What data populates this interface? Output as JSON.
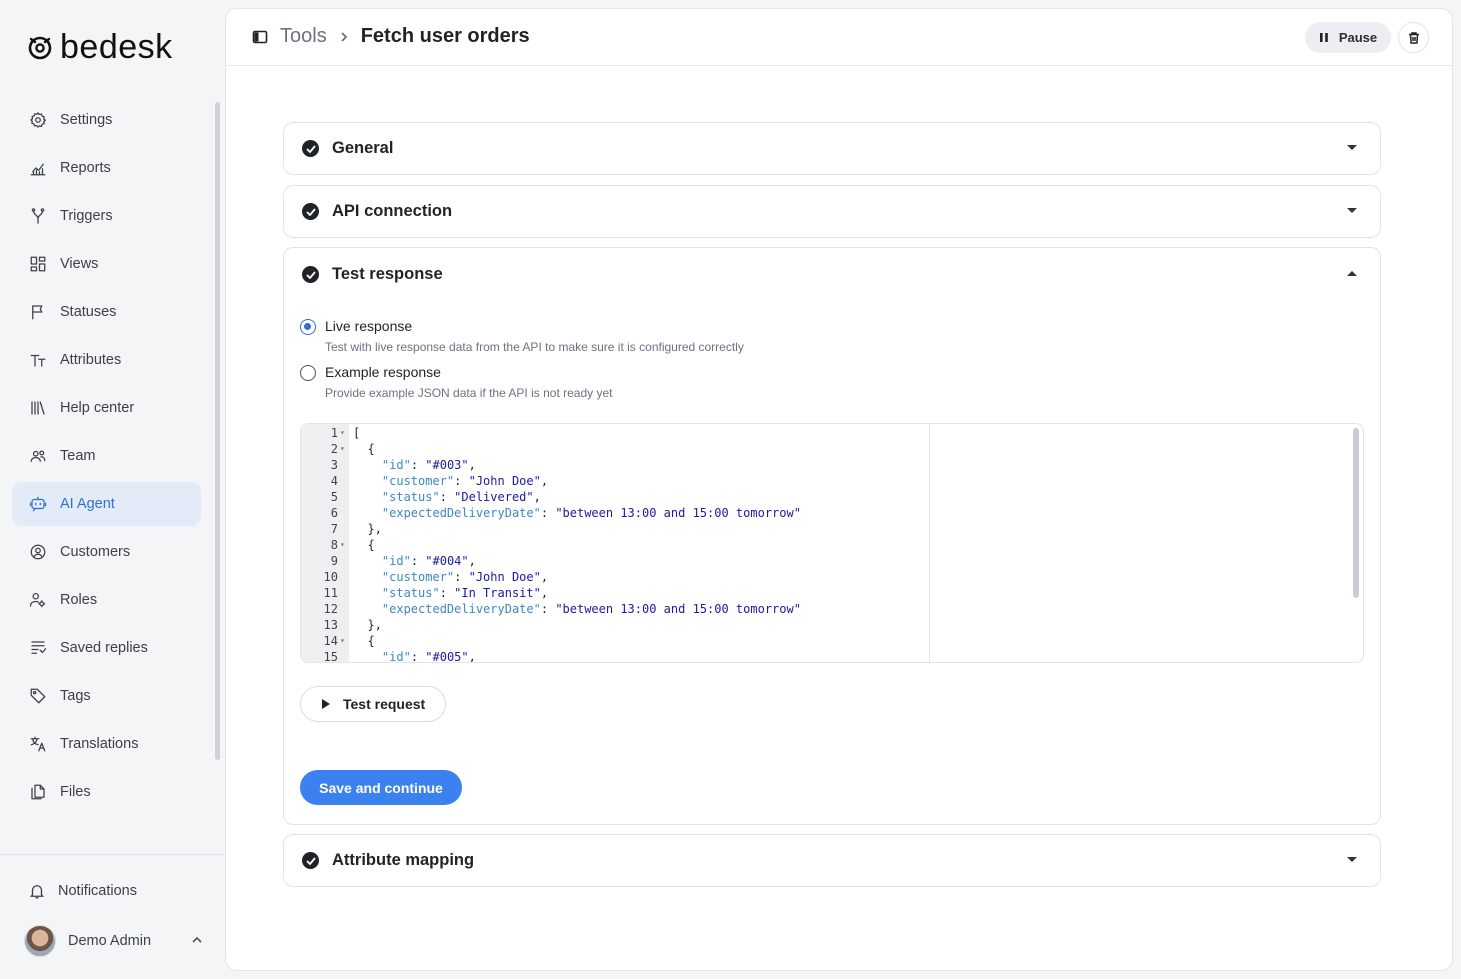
{
  "app": {
    "logo_text": "bedesk"
  },
  "sidebar": {
    "items": [
      {
        "label": "Settings",
        "icon": "gear-icon"
      },
      {
        "label": "Reports",
        "icon": "chart-icon"
      },
      {
        "label": "Triggers",
        "icon": "fork-icon"
      },
      {
        "label": "Views",
        "icon": "grid-icon"
      },
      {
        "label": "Statuses",
        "icon": "flag-icon"
      },
      {
        "label": "Attributes",
        "icon": "text-icon"
      },
      {
        "label": "Help center",
        "icon": "library-icon"
      },
      {
        "label": "Team",
        "icon": "team-icon"
      },
      {
        "label": "AI Agent",
        "icon": "bot-icon",
        "active": true
      },
      {
        "label": "Customers",
        "icon": "user-circle-icon"
      },
      {
        "label": "Roles",
        "icon": "user-gear-icon"
      },
      {
        "label": "Saved replies",
        "icon": "saved-reply-icon"
      },
      {
        "label": "Tags",
        "icon": "tag-icon"
      },
      {
        "label": "Translations",
        "icon": "translate-icon"
      },
      {
        "label": "Files",
        "icon": "files-icon"
      }
    ],
    "notifications_label": "Notifications",
    "user_name": "Demo Admin"
  },
  "header": {
    "breadcrumb_parent": "Tools",
    "title": "Fetch user orders",
    "pause_label": "Pause"
  },
  "sections": {
    "general": "General",
    "api_connection": "API connection",
    "test_response": "Test response",
    "attribute_mapping": "Attribute mapping"
  },
  "test_response": {
    "options": [
      {
        "label": "Live response",
        "description": "Test with live response data from the API to make sure it is configured correctly",
        "selected": true
      },
      {
        "label": "Example response",
        "description": "Provide example JSON data if the API is not ready yet",
        "selected": false
      }
    ],
    "editor_lines": [
      "[",
      "  {",
      "    \"id\": \"#003\",",
      "    \"customer\": \"John Doe\",",
      "    \"status\": \"Delivered\",",
      "    \"expectedDeliveryDate\": \"between 13:00 and 15:00 tomorrow\"",
      "  },",
      "  {",
      "    \"id\": \"#004\",",
      "    \"customer\": \"John Doe\",",
      "    \"status\": \"In Transit\",",
      "    \"expectedDeliveryDate\": \"between 13:00 and 15:00 tomorrow\"",
      "  },",
      "  {",
      "    \"id\": \"#005\","
    ],
    "foldable_lines": [
      1,
      2,
      8,
      14
    ],
    "test_request_label": "Test request",
    "save_label": "Save and continue"
  },
  "colors": {
    "accent": "#3b82f0",
    "active_nav_bg": "#e3ebf8",
    "json_key": "#3b88c4",
    "json_string": "#1a1aa6"
  }
}
